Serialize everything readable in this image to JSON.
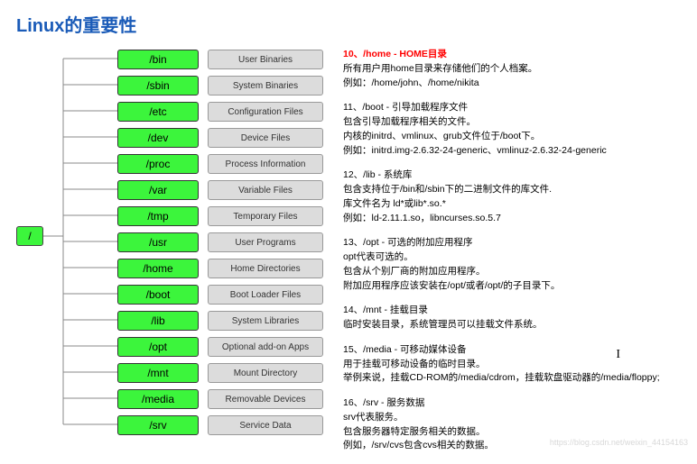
{
  "title": "Linux的重要性",
  "root": "/",
  "dirs": [
    {
      "name": "/bin",
      "desc": "User Binaries"
    },
    {
      "name": "/sbin",
      "desc": "System Binaries"
    },
    {
      "name": "/etc",
      "desc": "Configuration Files"
    },
    {
      "name": "/dev",
      "desc": "Device Files"
    },
    {
      "name": "/proc",
      "desc": "Process Information"
    },
    {
      "name": "/var",
      "desc": "Variable Files"
    },
    {
      "name": "/tmp",
      "desc": "Temporary Files"
    },
    {
      "name": "/usr",
      "desc": "User Programs"
    },
    {
      "name": "/home",
      "desc": "Home Directories"
    },
    {
      "name": "/boot",
      "desc": "Boot Loader Files"
    },
    {
      "name": "/lib",
      "desc": "System Libraries"
    },
    {
      "name": "/opt",
      "desc": "Optional add-on Apps"
    },
    {
      "name": "/mnt",
      "desc": "Mount Directory"
    },
    {
      "name": "/media",
      "desc": "Removable Devices"
    },
    {
      "name": "/srv",
      "desc": "Service Data"
    }
  ],
  "notes": {
    "n10_head": "10、/home - HOME目录",
    "n10_a": "所有用户用home目录来存储他们的个人档案。",
    "n10_b": "例如：/home/john、/home/nikita",
    "n11_head": "11、/boot - 引导加载程序文件",
    "n11_a": "包含引导加载程序相关的文件。",
    "n11_b": "内核的initrd、vmlinux、grub文件位于/boot下。",
    "n11_c": "例如：initrd.img-2.6.32-24-generic、vmlinuz-2.6.32-24-generic",
    "n12_head": "12、/lib - 系统库",
    "n12_a": "包含支持位于/bin和/sbin下的二进制文件的库文件.",
    "n12_b": "库文件名为 ld*或lib*.so.*",
    "n12_c": "例如：ld-2.11.1.so，libncurses.so.5.7",
    "n13_head": "13、/opt - 可选的附加应用程序",
    "n13_a": "opt代表可选的。",
    "n13_b": "包含从个别厂商的附加应用程序。",
    "n13_c": "附加应用程序应该安装在/opt/或者/opt/的子目录下。",
    "n14_head": "14、/mnt - 挂载目录",
    "n14_a": "临时安装目录，系统管理员可以挂载文件系统。",
    "n15_head": "15、/media - 可移动媒体设备",
    "n15_a": "用于挂载可移动设备的临时目录。",
    "n15_b": "举例来说，挂载CD-ROM的/media/cdrom，挂载软盘驱动器的/media/floppy;",
    "n16_head": "16、/srv - 服务数据",
    "n16_a": "srv代表服务。",
    "n16_b": "包含服务器特定服务相关的数据。",
    "n16_c": "例如，/srv/cvs包含cvs相关的数据。"
  },
  "watermark": "https://blog.csdn.net/weixin_44154163"
}
